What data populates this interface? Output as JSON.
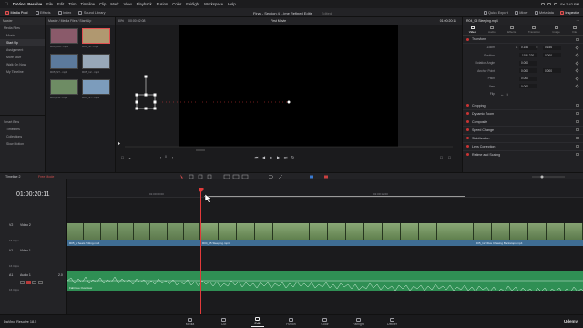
{
  "menubar": {
    "app": "DaVinci Resolve",
    "items": [
      "File",
      "Edit",
      "Trim",
      "Timeline",
      "Clip",
      "Mark",
      "View",
      "Playback",
      "Fusion",
      "Color",
      "Fairlight",
      "Workspace",
      "Help"
    ],
    "clock": "Fri 2:42 PM"
  },
  "toolbar": {
    "left_buttons": [
      "Media Pool",
      "Effects",
      "Index",
      "Sound Library"
    ],
    "project_title": "Final - Section 4 ...ime  Refined Edits",
    "edited": "Edited",
    "right_buttons": [
      "Quick Export",
      "Mixer",
      "Metadata",
      "Inspector"
    ]
  },
  "sidebar": {
    "header": "Master",
    "items": [
      {
        "label": "Media Files",
        "root": true,
        "selected": false
      },
      {
        "label": "Music",
        "root": false,
        "selected": false
      },
      {
        "label": "Start Up",
        "root": false,
        "selected": true
      },
      {
        "label": "Assignment",
        "root": false,
        "selected": false
      },
      {
        "label": "More Stuff",
        "root": false,
        "selected": false
      },
      {
        "label": "Walk On Nowl",
        "root": false,
        "selected": false
      },
      {
        "label": "My Timeline",
        "root": false,
        "selected": false
      }
    ],
    "smart_bins_label": "Smart Bins",
    "smart_items": [
      "Timelines",
      "Collections",
      "Slow Motion"
    ]
  },
  "media_pool": {
    "path": "Master / Media Files / Start Up",
    "clips": [
      {
        "name": "R04_Wo...mp4",
        "color": "#8a5a6a",
        "selected": false
      },
      {
        "name": "R04_Sl...mp4",
        "color": "#b09870",
        "selected": true
      },
      {
        "name": "R05_ST...mp4",
        "color": "#5c7a9c",
        "selected": false
      },
      {
        "name": "R05_12...mp4",
        "color": "#98a8b8",
        "selected": false
      },
      {
        "name": "R05_Pa...mp4",
        "color": "#6e8c64",
        "selected": false
      },
      {
        "name": "R05_ST...mp4",
        "color": "#7c9cbc",
        "selected": false
      }
    ]
  },
  "viewer": {
    "zoom": "30%",
    "timecode_left": "00:00:02:08",
    "clip_name": "First Movie",
    "timecode_right": "01:00:20:11",
    "frame_counter": "0"
  },
  "inspector": {
    "clip_name": "R04_05 Sleeping.mp4",
    "tabs": [
      "Video",
      "Audio",
      "Effects",
      "Transition",
      "Image",
      "File"
    ],
    "active_tab": "Video",
    "transform_label": "Transform",
    "rows": [
      {
        "label": "Zoom",
        "x": "0.156",
        "y": "0.156"
      },
      {
        "label": "Position",
        "x": "-1191.220",
        "y": "0.000"
      },
      {
        "label": "Rotation Angle",
        "x": "0.000",
        "y": ""
      },
      {
        "label": "Anchor Point",
        "x": "0.000",
        "y": "0.000"
      },
      {
        "label": "Pitch",
        "x": "0.000",
        "y": ""
      },
      {
        "label": "Yaw",
        "x": "0.000",
        "y": ""
      },
      {
        "label": "Flip",
        "x": "",
        "y": ""
      }
    ],
    "sections": [
      "Cropping",
      "Dynamic Zoom",
      "Composite",
      "Speed Change",
      "Stabilization",
      "Lens Correction",
      "Retime and Scaling"
    ]
  },
  "timeline": {
    "name": "Timeline 2",
    "mode": "Free Mode",
    "timecode": "01:00:20:11",
    "ruler_labels": [
      "01:00:00:00",
      "01:00:12:00"
    ],
    "tracks": [
      {
        "id": "V2",
        "name": "Video 2",
        "clips_count": "16 Clips"
      },
      {
        "id": "V1",
        "name": "Video 1",
        "clips_count": "16 Clips"
      },
      {
        "id": "A1",
        "name": "Audio 1",
        "level": "2.0",
        "clips_count": "16 Clips"
      }
    ],
    "video_clips": [
      {
        "label": "R05_2 Seats Sitting.mp4"
      },
      {
        "label": "R04_05 Sleeping.mp4"
      },
      {
        "label": "R05_12 Olive Chasing Backstops.mp4"
      }
    ],
    "audio_clip_label": "Fabrique Overview"
  },
  "bottom": {
    "brand": "DaVinci Resolve 18.5",
    "pages": [
      "Media",
      "Cut",
      "Edit",
      "Fusion",
      "Color",
      "Fairlight",
      "Deliver"
    ],
    "active_page": "Edit",
    "watermark": "Udemy"
  }
}
